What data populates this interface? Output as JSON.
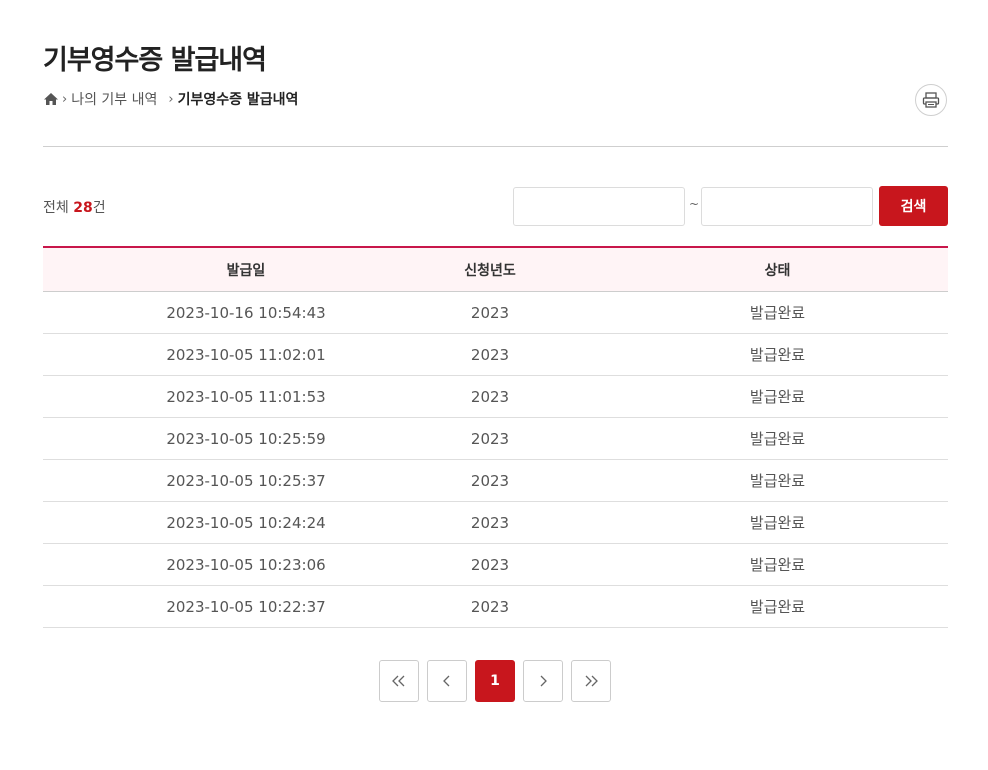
{
  "page": {
    "title": "기부영수증 발급내역"
  },
  "breadcrumb": {
    "home_icon": "home-icon",
    "items": [
      "나의 기부 내역",
      "기부영수증 발급내역"
    ]
  },
  "toolbar": {
    "print_icon": "print-icon"
  },
  "search": {
    "total_prefix": "전체",
    "total_count": "28",
    "total_suffix": "건",
    "from_value": "",
    "to_value": "",
    "separator": "~",
    "button_label": "검색"
  },
  "table": {
    "headers": [
      "발급일",
      "신청년도",
      "상태"
    ],
    "rows": [
      [
        "2023-10-16 10:54:43",
        "2023",
        "발급완료"
      ],
      [
        "2023-10-05 11:02:01",
        "2023",
        "발급완료"
      ],
      [
        "2023-10-05 11:01:53",
        "2023",
        "발급완료"
      ],
      [
        "2023-10-05 10:25:59",
        "2023",
        "발급완료"
      ],
      [
        "2023-10-05 10:25:37",
        "2023",
        "발급완료"
      ],
      [
        "2023-10-05 10:24:24",
        "2023",
        "발급완료"
      ],
      [
        "2023-10-05 10:23:06",
        "2023",
        "발급완료"
      ],
      [
        "2023-10-05 10:22:37",
        "2023",
        "발급완료"
      ]
    ]
  },
  "pagination": {
    "first_icon": "double-chevron-left-icon",
    "prev_icon": "chevron-left-icon",
    "current_page": "1",
    "next_icon": "chevron-right-icon",
    "last_icon": "double-chevron-right-icon"
  },
  "colors": {
    "accent": "#c8161d",
    "header_bg": "#fff4f6",
    "header_border": "#c8164a"
  }
}
